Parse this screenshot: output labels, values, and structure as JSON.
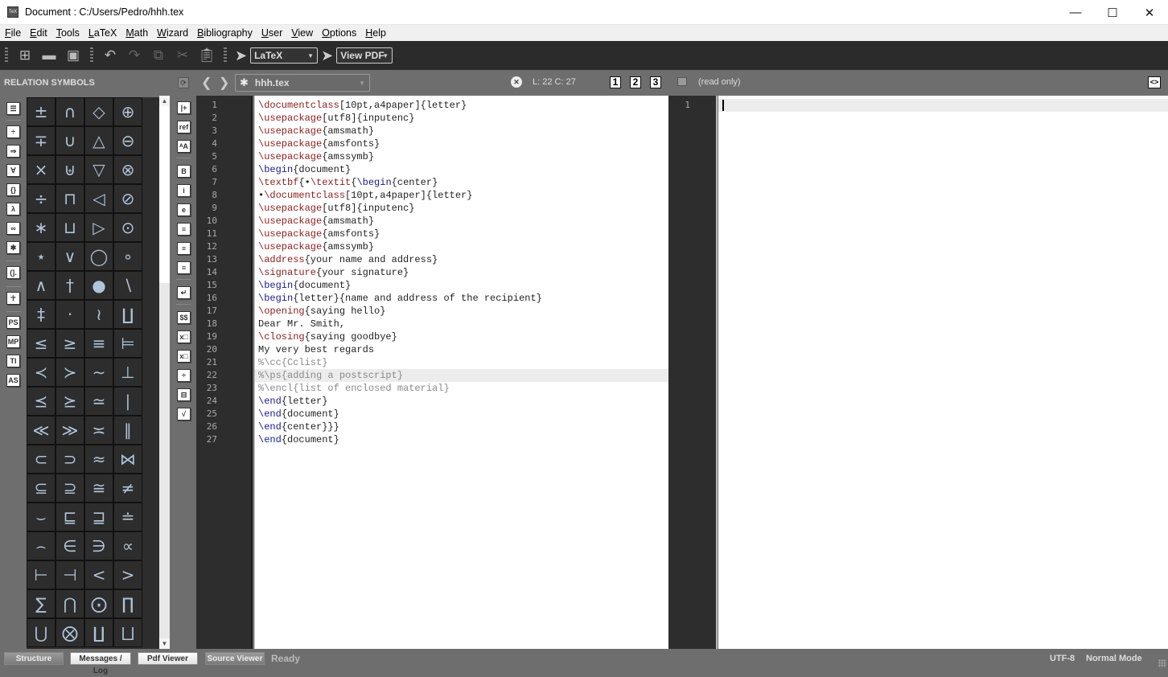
{
  "window": {
    "title": "Document : C:/Users/Pedro/hhh.tex",
    "app_icon": "texstudio-icon",
    "minimize": "—",
    "maximize": "☐",
    "close": "✕"
  },
  "menu": [
    {
      "u": "F",
      "rest": "ile"
    },
    {
      "u": "E",
      "rest": "dit"
    },
    {
      "u": "T",
      "rest": "ools"
    },
    {
      "pre": "",
      "u": "L",
      "rest": "aTeX"
    },
    {
      "u": "M",
      "rest": "ath"
    },
    {
      "u": "W",
      "rest": "izard"
    },
    {
      "u": "B",
      "rest": "ibliography"
    },
    {
      "u": "U",
      "rest": "ser"
    },
    {
      "u": "V",
      "rest": "iew"
    },
    {
      "u": "O",
      "rest": "ptions"
    },
    {
      "u": "H",
      "rest": "elp"
    }
  ],
  "toolbar": {
    "new": "new-file-icon",
    "open": "open-folder-icon",
    "save": "save-icon",
    "undo": "undo-icon",
    "redo": "redo-icon",
    "copy": "copy-icon",
    "cut": "cut-icon",
    "paste": "paste-icon",
    "compiler": "LaTeX",
    "viewer": "View PDF"
  },
  "side_panel": {
    "title": "RELATION SYMBOLS",
    "categories": [
      "☰",
      "÷",
      "⇒",
      "∀",
      "{}",
      "λ",
      "∞",
      "✱",
      "(].",
      "☥",
      "PS",
      "MP",
      "TI",
      "AS"
    ],
    "symbols": [
      "±",
      "∩",
      "◇",
      "⊕",
      "∓",
      "∪",
      "△",
      "⊖",
      "×",
      "⊎",
      "▽",
      "⊗",
      "÷",
      "⊓",
      "◁",
      "⊘",
      "∗",
      "⊔",
      "▷",
      "⊙",
      "⋆",
      "∨",
      "◯",
      "∘",
      "∧",
      "†",
      "●",
      "∖",
      "‡",
      "·",
      "≀",
      "∐",
      "≤",
      "≥",
      "≡",
      "⊨",
      "≺",
      "≻",
      "∼",
      "⊥",
      "⪯",
      "⪰",
      "≃",
      "∣",
      "≪",
      "≫",
      "≍",
      "∥",
      "⊂",
      "⊃",
      "≈",
      "⋈",
      "⊆",
      "⊇",
      "≅",
      "≠",
      "⌣",
      "⊑",
      "⊒",
      "≐",
      "⌢",
      "∈",
      "∋",
      "∝",
      "⊢",
      "⊣",
      "<",
      ">",
      "∑",
      "⋂",
      "⨀",
      "∏",
      "⋃",
      "⨂",
      "∐",
      "⨆"
    ]
  },
  "format_toolbar": [
    "|+",
    "ref",
    "ᴬA",
    "B",
    "i",
    "e",
    "≡",
    "≡",
    "≡",
    "↵",
    "$$",
    "x□",
    "x□",
    "÷",
    "⊟",
    "√"
  ],
  "editor": {
    "file_name": "hhh.tex",
    "modified_icon": "✱",
    "cursor": "L: 22 C: 27",
    "views": [
      "1",
      "2",
      "3"
    ],
    "read_only": "(read only)",
    "toggle": "<>",
    "current_line": 22,
    "lines": [
      [
        [
          "kw",
          "\\documentclass"
        ],
        [
          "",
          "[10pt,a4paper]{letter}"
        ]
      ],
      [
        [
          "kw",
          "\\usepackage"
        ],
        [
          "",
          "[utf8]{inputenc}"
        ]
      ],
      [
        [
          "kw",
          "\\usepackage"
        ],
        [
          "",
          "{amsmath}"
        ]
      ],
      [
        [
          "kw",
          "\\usepackage"
        ],
        [
          "",
          "{amsfonts}"
        ]
      ],
      [
        [
          "kw",
          "\\usepackage"
        ],
        [
          "",
          "{amssymb}"
        ]
      ],
      [
        [
          "kb",
          "\\begin"
        ],
        [
          "",
          "{document}"
        ]
      ],
      [
        [
          "kw",
          "\\textbf"
        ],
        [
          "",
          "{•"
        ],
        [
          "kw",
          "\\textit"
        ],
        [
          "",
          "{"
        ],
        [
          "kb",
          "\\begin"
        ],
        [
          "",
          "{center}"
        ]
      ],
      [
        [
          "",
          "•"
        ],
        [
          "kw",
          "\\documentclass"
        ],
        [
          "",
          "[10pt,a4paper]{letter}"
        ]
      ],
      [
        [
          "kw",
          "\\usepackage"
        ],
        [
          "",
          "[utf8]{inputenc}"
        ]
      ],
      [
        [
          "kw",
          "\\usepackage"
        ],
        [
          "",
          "{amsmath}"
        ]
      ],
      [
        [
          "kw",
          "\\usepackage"
        ],
        [
          "",
          "{amsfonts}"
        ]
      ],
      [
        [
          "kw",
          "\\usepackage"
        ],
        [
          "",
          "{amssymb}"
        ]
      ],
      [
        [
          "kw",
          "\\address"
        ],
        [
          "",
          "{your name and address}"
        ]
      ],
      [
        [
          "kw",
          "\\signature"
        ],
        [
          "",
          "{your signature}"
        ]
      ],
      [
        [
          "kb",
          "\\begin"
        ],
        [
          "",
          "{document}"
        ]
      ],
      [
        [
          "kb",
          "\\begin"
        ],
        [
          "",
          "{letter}{name and address of the recipient}"
        ]
      ],
      [
        [
          "kw",
          "\\opening"
        ],
        [
          "",
          "{saying hello}"
        ]
      ],
      [
        [
          "",
          "Dear Mr. Smith,"
        ]
      ],
      [
        [
          "kw",
          "\\closing"
        ],
        [
          "",
          "{saying goodbye}"
        ]
      ],
      [
        [
          "",
          "My very best regards"
        ]
      ],
      [
        [
          "cm",
          "%\\cc{Cclist}"
        ]
      ],
      [
        [
          "cm",
          "%\\ps{adding a postscript}"
        ]
      ],
      [
        [
          "cm",
          "%\\encl{list of enclosed material}"
        ]
      ],
      [
        [
          "kb",
          "\\end"
        ],
        [
          "",
          "{letter}"
        ]
      ],
      [
        [
          "kb",
          "\\end"
        ],
        [
          "",
          "{document}"
        ]
      ],
      [
        [
          "kb",
          "\\end"
        ],
        [
          "",
          "{center}}}"
        ]
      ],
      [
        [
          "kb",
          "\\end"
        ],
        [
          "",
          "{document}"
        ]
      ]
    ]
  },
  "preview": {
    "line_numbers": [
      "1"
    ]
  },
  "statusbar": {
    "tabs": [
      {
        "label": "Structure",
        "active": false
      },
      {
        "label": "Messages / Log",
        "active": true
      },
      {
        "label": "Pdf Viewer",
        "active": true
      },
      {
        "label": "Source Viewer",
        "active": false
      }
    ],
    "status": "Ready",
    "encoding": "UTF-8",
    "mode": "Normal Mode"
  }
}
